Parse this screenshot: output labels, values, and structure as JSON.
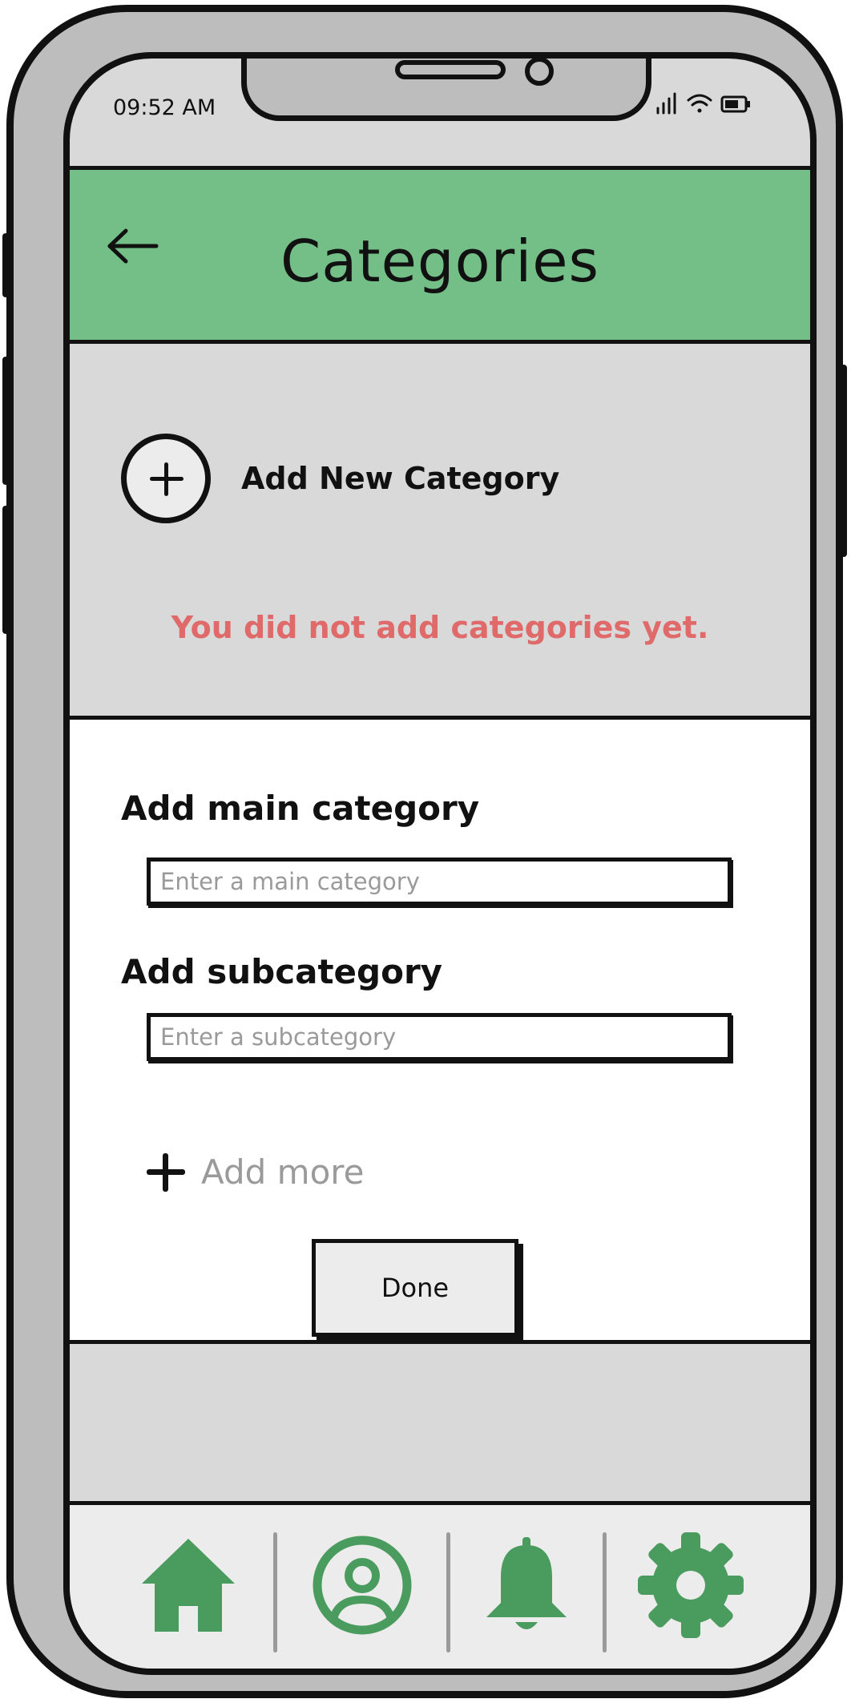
{
  "status_bar": {
    "time": "09:52 AM"
  },
  "header": {
    "title": "Categories",
    "back_icon": "arrow-left-icon",
    "color": "#74bf87"
  },
  "add_category": {
    "label": "Add New Category",
    "icon": "plus-circle-icon"
  },
  "empty_state": {
    "message": "You did not add categories yet.",
    "color": "#e06a6a"
  },
  "form": {
    "main_category_label": "Add main category",
    "main_category_placeholder": "Enter a main category",
    "main_category_value": "",
    "subcategory_label": "Add subcategory",
    "subcategory_placeholder": "Enter a subcategory",
    "subcategory_value": "",
    "add_more_label": "Add more",
    "done_label": "Done"
  },
  "bottom_nav": {
    "items": [
      {
        "name": "home",
        "icon": "home-icon"
      },
      {
        "name": "profile",
        "icon": "user-circle-icon"
      },
      {
        "name": "notifications",
        "icon": "bell-icon"
      },
      {
        "name": "settings",
        "icon": "gear-icon"
      }
    ],
    "icon_color": "#4a9b5e"
  }
}
